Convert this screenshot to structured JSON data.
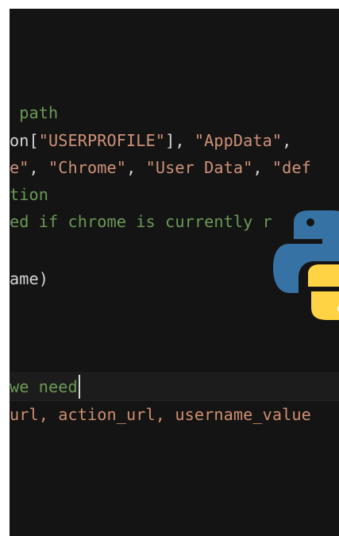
{
  "editor": {
    "lines": {
      "l1": {
        "comment": " path"
      },
      "l2": {
        "pre": "on[",
        "s1": "\"USERPROFILE\"",
        "mid": "], ",
        "s2": "\"AppData\"",
        "post": ","
      },
      "l3": {
        "s1": "e\"",
        "sep1": ", ",
        "s2": "\"Chrome\"",
        "sep2": ", ",
        "s3": "\"User Data\"",
        "sep3": ", ",
        "s4": "\"def"
      },
      "l4": {
        "comment": "tion"
      },
      "l5": {
        "comment": "ed if chrome is currently r"
      },
      "l6": {
        "code": "ame)"
      },
      "l7": {
        "comment": "we need"
      },
      "l8": {
        "code": "url, action_url, username_value"
      }
    }
  },
  "logo": {
    "icon": "python-logo",
    "colors": {
      "blue": "#3772a4",
      "yellow": "#ffd343"
    }
  },
  "colors": {
    "background": "#141414",
    "comment": "#6a9955",
    "string": "#ce9178",
    "text": "#d4d4d4"
  }
}
